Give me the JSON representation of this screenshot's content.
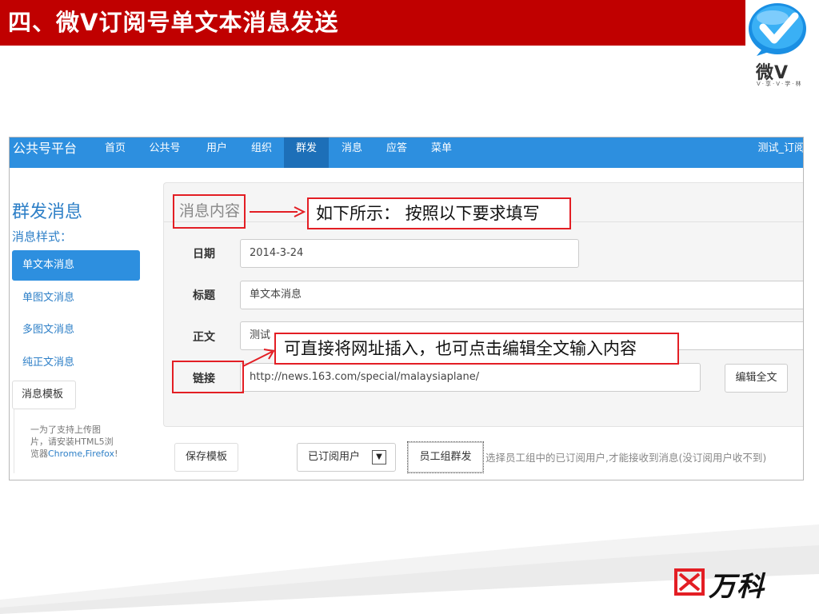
{
  "slide": {
    "title": "四、微V订阅号单文本消息发送",
    "logo_text": "微V",
    "logo_sub": "V·享·V·学·林",
    "brand_footer": "万科"
  },
  "navbar": {
    "brand": "公共号平台",
    "items": [
      "首页",
      "公共号",
      "用户",
      "组织",
      "群发",
      "消息",
      "应答",
      "菜单"
    ],
    "active_item": "群发",
    "user": "测试_订阅"
  },
  "sidebar": {
    "title": "群发消息",
    "subtitle": "消息样式：",
    "items": [
      "单文本消息",
      "单图文消息",
      "多图文消息",
      "纯正文消息"
    ],
    "active_item": "单文本消息",
    "template_button": "消息模板",
    "note_line1": "一为了支持上传图",
    "note_line2": "片，请安装HTML5浏",
    "note_line3_prefix": "览器",
    "note_browsers": "Chrome,Firefox",
    "note_line3_suffix": "!"
  },
  "form": {
    "panel_title": "消息内容",
    "date_label": "日期",
    "date_value": "2014-3-24",
    "title_label": "标题",
    "title_value": "单文本消息",
    "body_label": "正文",
    "body_value": "测试",
    "link_label": "链接",
    "link_value": "http://news.163.com/special/malaysiaplane/",
    "edit_button": "编辑全文"
  },
  "bottom": {
    "save_button": "保存模板",
    "audience_select": "已订阅用户",
    "group_send_button": "员工组群发",
    "hint": "选择员工组中的已订阅用户,才能接收到消息(没订阅用户收不到)"
  },
  "annotations": {
    "fill_hint": "如下所示： 按照以下要求填写",
    "link_hint": "可直接将网址插入，也可点击编辑全文输入内容"
  },
  "colors": {
    "title_bar": "#c00000",
    "navbar": "#2d8fdf",
    "accent_blue": "#2d7fc7",
    "annotation_red": "#e31e24"
  }
}
